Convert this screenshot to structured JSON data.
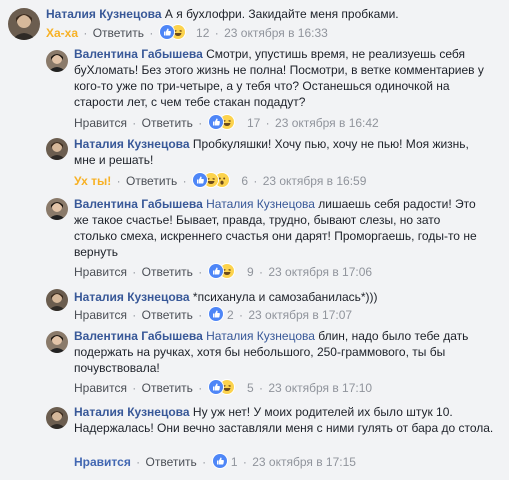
{
  "comments": [
    {
      "author": "Наталия Кузнецова",
      "text": " А я бухлофри. Закидайте меня пробками.",
      "reaction_label": "Ха-ха",
      "reply": "Ответить",
      "count": "12",
      "time": "23 октября в 16:33"
    },
    {
      "author": "Валентина Габышева",
      "text": " Смотри, упустишь время, не реализуешь себя буХломать! Без этого жизнь не полна! Посмотри, в ветке комментариев у кого-то уже по три-четыре, а у тебя что? Останешься одиночкой на старости лет, с чем тебе стакан подадут?",
      "like": "Нравится",
      "reply": "Ответить",
      "count": "17",
      "time": "23 октября в 16:42"
    },
    {
      "author": "Наталия Кузнецова",
      "text": " Пробкуляшки! Хочу пью, хочу не пью! Моя жизнь, мне и решать!",
      "reaction_label": "Ух ты!",
      "reply": "Ответить",
      "count": "6",
      "time": "23 октября в 16:59"
    },
    {
      "author": "Валентина Габышева",
      "mention": "Наталия Кузнецова",
      "text": " лишаешь себя радости! Это же такое счастье! Бывает, правда, трудно, бывают слезы, но зато столько смеха, искреннего счастья они дарят! Проморгаешь, годы-то не вернуть",
      "like": "Нравится",
      "reply": "Ответить",
      "count": "9",
      "time": "23 октября в 17:06"
    },
    {
      "author": "Наталия Кузнецова",
      "text": " *психанула и самозабанилась*)))",
      "like": "Нравится",
      "reply": "Ответить",
      "count": "2",
      "time": "23 октября в 17:07"
    },
    {
      "author": "Валентина Габышева",
      "mention": "Наталия Кузнецова",
      "text": " блин, надо было тебе дать подержать на ручках, хотя бы небольшого, 250-граммового, ты бы почувствовала!",
      "like": "Нравится",
      "reply": "Ответить",
      "count": "5",
      "time": "23 октября в 17:10"
    },
    {
      "author": "Наталия Кузнецова",
      "text": " Ну уж нет! У моих родителей их было штук 10. Надержалась! Они вечно заставляли меня с ними гулять от бара до стола.",
      "like": "Нравится",
      "reply": "Ответить",
      "count": "1",
      "time": "23 октября в 17:15"
    }
  ],
  "colors": {
    "author": "#385898",
    "meta": "#90949c",
    "haha_label": "#f7b125",
    "like_active": "#4267b2",
    "background": "#f2f3f5"
  },
  "icons": {
    "like": "like-icon",
    "haha": "haha-icon",
    "wow": "wow-icon"
  }
}
